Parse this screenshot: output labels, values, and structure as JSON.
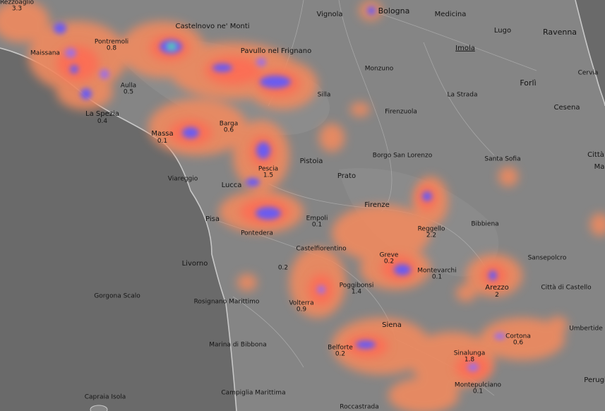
{
  "map": {
    "colors": {
      "sea": "#6a6a6a",
      "land": "#8a8a8a",
      "heat_low": "#f08a5e",
      "heat_mid": "#ff6a52",
      "heat_high": "#a070e0",
      "heat_peak": "#6a5cf0",
      "heat_max": "#49e08e"
    },
    "labels": [
      {
        "id": "rezzoaglio",
        "name": "Rezzoaglio",
        "value": "3.3",
        "size": "small"
      },
      {
        "id": "bologna",
        "name": "Bologna",
        "value": "",
        "size": "large"
      },
      {
        "id": "vignola",
        "name": "Vignola",
        "value": "",
        "size": "medium"
      },
      {
        "id": "medicina",
        "name": "Medicina",
        "value": "",
        "size": "medium"
      },
      {
        "id": "castelnovo",
        "name": "Castelnovo ne' Monti",
        "value": "",
        "size": "medium"
      },
      {
        "id": "lugo",
        "name": "Lugo",
        "value": "",
        "size": "medium"
      },
      {
        "id": "ravenna",
        "name": "Ravenna",
        "value": "",
        "size": "large"
      },
      {
        "id": "maissana",
        "name": "Maissana",
        "value": "",
        "size": "small"
      },
      {
        "id": "pontremoli",
        "name": "Pontremoli",
        "value": "0.8",
        "size": "small"
      },
      {
        "id": "pavullo",
        "name": "Pavullo nel Frignano",
        "value": "",
        "size": "medium"
      },
      {
        "id": "imola",
        "name": "Imola",
        "value": "",
        "size": "medium",
        "underline": true
      },
      {
        "id": "monzuno",
        "name": "Monzuno",
        "value": "",
        "size": "small"
      },
      {
        "id": "cervia",
        "name": "Cervia",
        "value": "",
        "size": "small"
      },
      {
        "id": "aulla",
        "name": "Aulla",
        "value": "0.5",
        "size": "small"
      },
      {
        "id": "forli",
        "name": "Forlì",
        "value": "",
        "size": "large"
      },
      {
        "id": "lastrada",
        "name": "La Strada",
        "value": "",
        "size": "small"
      },
      {
        "id": "silla",
        "name": "Silla",
        "value": "",
        "size": "small"
      },
      {
        "id": "cesena",
        "name": "Cesena",
        "value": "",
        "size": "medium"
      },
      {
        "id": "laspezia",
        "name": "La Spezia",
        "value": "0.4",
        "size": "medium"
      },
      {
        "id": "firenzuola",
        "name": "Firenzuola",
        "value": "",
        "size": "small"
      },
      {
        "id": "barga",
        "name": "Barga",
        "value": "0.6",
        "size": "small"
      },
      {
        "id": "massa",
        "name": "Massa",
        "value": "0.1",
        "size": "medium"
      },
      {
        "id": "borgo",
        "name": "Borgo San Lorenzo",
        "value": "",
        "size": "small"
      },
      {
        "id": "santasofia",
        "name": "Santa Sofia",
        "value": "",
        "size": "small"
      },
      {
        "id": "citta_edge",
        "name": "Città",
        "value": "",
        "size": "medium"
      },
      {
        "id": "ma_edge",
        "name": "Ma",
        "value": "",
        "size": "medium"
      },
      {
        "id": "pistoia",
        "name": "Pistoia",
        "value": "",
        "size": "medium"
      },
      {
        "id": "pescia",
        "name": "Pescia",
        "value": "1.5",
        "size": "small"
      },
      {
        "id": "viareggio",
        "name": "Viareggio",
        "value": "",
        "size": "small"
      },
      {
        "id": "prato",
        "name": "Prato",
        "value": "",
        "size": "medium"
      },
      {
        "id": "lucca",
        "name": "Lucca",
        "value": "",
        "size": "medium"
      },
      {
        "id": "firenze",
        "name": "Firenze",
        "value": "",
        "size": "medium"
      },
      {
        "id": "pisa",
        "name": "Pisa",
        "value": "",
        "size": "medium"
      },
      {
        "id": "empoli",
        "name": "Empoli",
        "value": "0.1",
        "size": "small"
      },
      {
        "id": "bibbiena",
        "name": "Bibbiena",
        "value": "",
        "size": "small"
      },
      {
        "id": "reggello",
        "name": "Reggello",
        "value": "2.2",
        "size": "small"
      },
      {
        "id": "pontedera",
        "name": "Pontedera",
        "value": "",
        "size": "small"
      },
      {
        "id": "castelfiorentino",
        "name": "Castelfiorentino",
        "value": "",
        "size": "small"
      },
      {
        "id": "greve",
        "name": "Greve",
        "value": "0.2",
        "size": "small"
      },
      {
        "id": "sansepolcro",
        "name": "Sansepolcro",
        "value": "",
        "size": "small"
      },
      {
        "id": "livorno",
        "name": "Livorno",
        "value": "",
        "size": "medium"
      },
      {
        "id": "val_0_2",
        "name": "",
        "value": "0.2",
        "size": "small"
      },
      {
        "id": "montevarchi",
        "name": "Montevarchi",
        "value": "0.1",
        "size": "small"
      },
      {
        "id": "arezzo",
        "name": "Arezzo",
        "value": "2",
        "size": "medium"
      },
      {
        "id": "poggibonsi",
        "name": "Poggibonsi",
        "value": "1.4",
        "size": "small"
      },
      {
        "id": "cittadicastello",
        "name": "Città di Castello",
        "value": "",
        "size": "small"
      },
      {
        "id": "gorgona",
        "name": "Gorgona Scalo",
        "value": "",
        "size": "small"
      },
      {
        "id": "rosignano",
        "name": "Rosignano Marittimo",
        "value": "",
        "size": "small"
      },
      {
        "id": "volterra",
        "name": "Volterra",
        "value": "0.9",
        "size": "small"
      },
      {
        "id": "siena",
        "name": "Siena",
        "value": "",
        "size": "medium"
      },
      {
        "id": "umbertide",
        "name": "Umbertide",
        "value": "",
        "size": "small"
      },
      {
        "id": "cortona",
        "name": "Cortona",
        "value": "0.6",
        "size": "small"
      },
      {
        "id": "marina",
        "name": "Marina di Bibbona",
        "value": "",
        "size": "small"
      },
      {
        "id": "belforte",
        "name": "Belforte",
        "value": "0.2",
        "size": "small"
      },
      {
        "id": "sinalunga",
        "name": "Sinalunga",
        "value": "1.8",
        "size": "small"
      },
      {
        "id": "perugia_edge",
        "name": "Perugi",
        "value": "",
        "size": "medium"
      },
      {
        "id": "montepulciano",
        "name": "Montepulciano",
        "value": "0.1",
        "size": "small"
      },
      {
        "id": "campiglia",
        "name": "Campiglia Marittima",
        "value": "",
        "size": "small"
      },
      {
        "id": "capraia",
        "name": "Capraia Isola",
        "value": "",
        "size": "small"
      },
      {
        "id": "roccastrada",
        "name": "Roccastrada",
        "value": "",
        "size": "small"
      }
    ]
  }
}
